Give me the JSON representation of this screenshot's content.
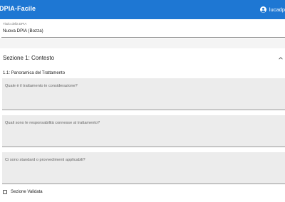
{
  "app": {
    "title": "DPIA-Facile",
    "user_name": "lucadp",
    "user_icon": "account-circle-icon",
    "accent_color": "#1e77d3"
  },
  "document": {
    "title_label": "Titolo della DPIA",
    "title_value": "Nuova DPIA (Bozza)"
  },
  "section": {
    "title": "Sezione 1: Contesto",
    "expanded": true,
    "toggle_icon": "chevron-up-icon",
    "subheading": "1.1: Panoramica del Trattamento",
    "fields": [
      {
        "placeholder": "Quale è il trattamento in considerazione?"
      },
      {
        "placeholder": "Quali sono le responsabilità connesse al trattamento?"
      },
      {
        "placeholder": "Ci sono standard o provvedimenti applicabili?"
      }
    ],
    "validated_label": "Sezione Validata",
    "validated_checked": false
  }
}
